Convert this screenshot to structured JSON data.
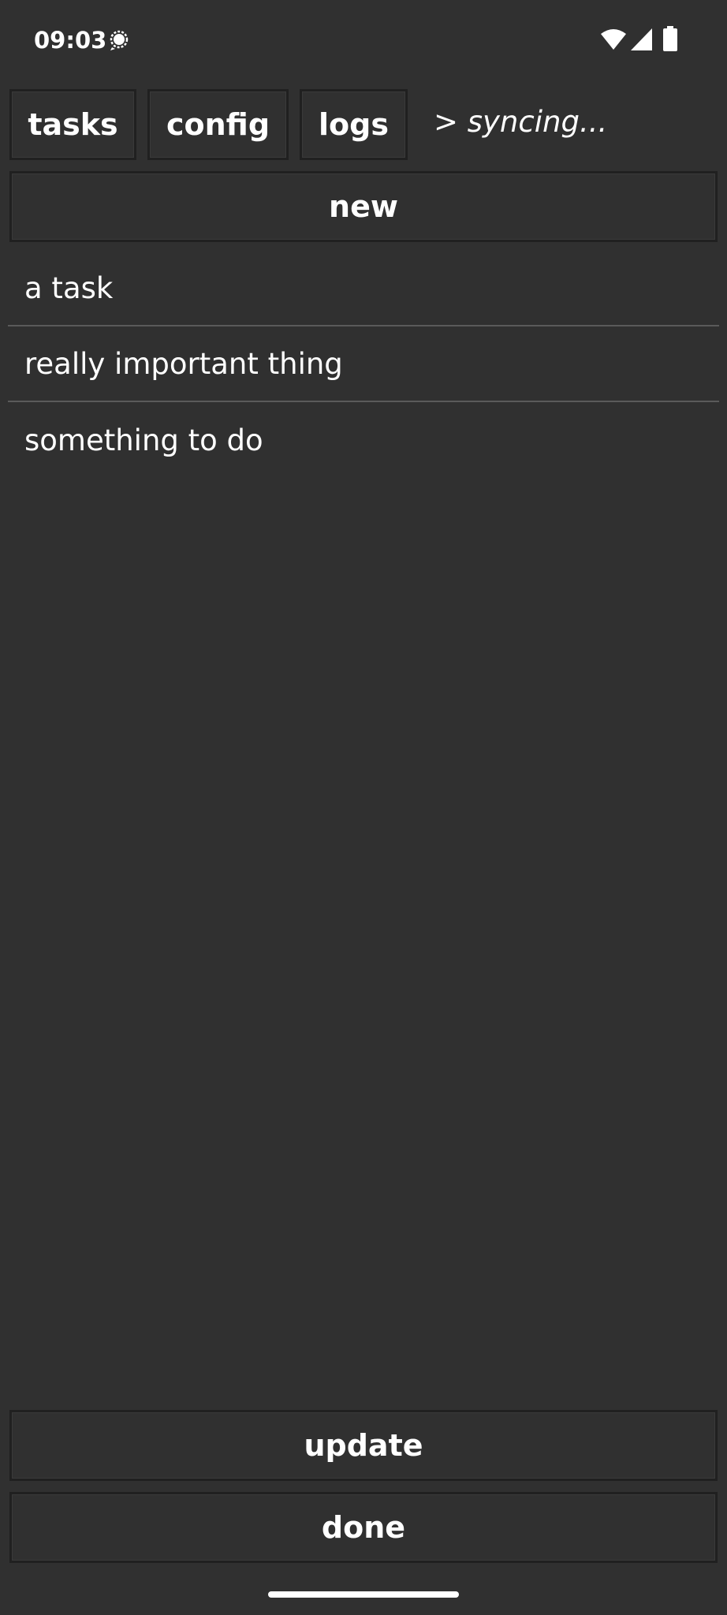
{
  "status_bar": {
    "time": "09:03",
    "icons": [
      "notification-icon",
      "wifi-icon",
      "signal-icon",
      "battery-icon"
    ]
  },
  "tabs": [
    {
      "label": "tasks"
    },
    {
      "label": "config"
    },
    {
      "label": "logs"
    }
  ],
  "sync_status": "> syncing...",
  "new_button": "new",
  "tasks": [
    "a task",
    "really important thing",
    "something to do"
  ],
  "actions": {
    "update": "update",
    "done": "done"
  },
  "colors": {
    "background": "#303030",
    "button_border": "#202020",
    "divider": "#5a5a5a",
    "text": "#ffffff"
  }
}
